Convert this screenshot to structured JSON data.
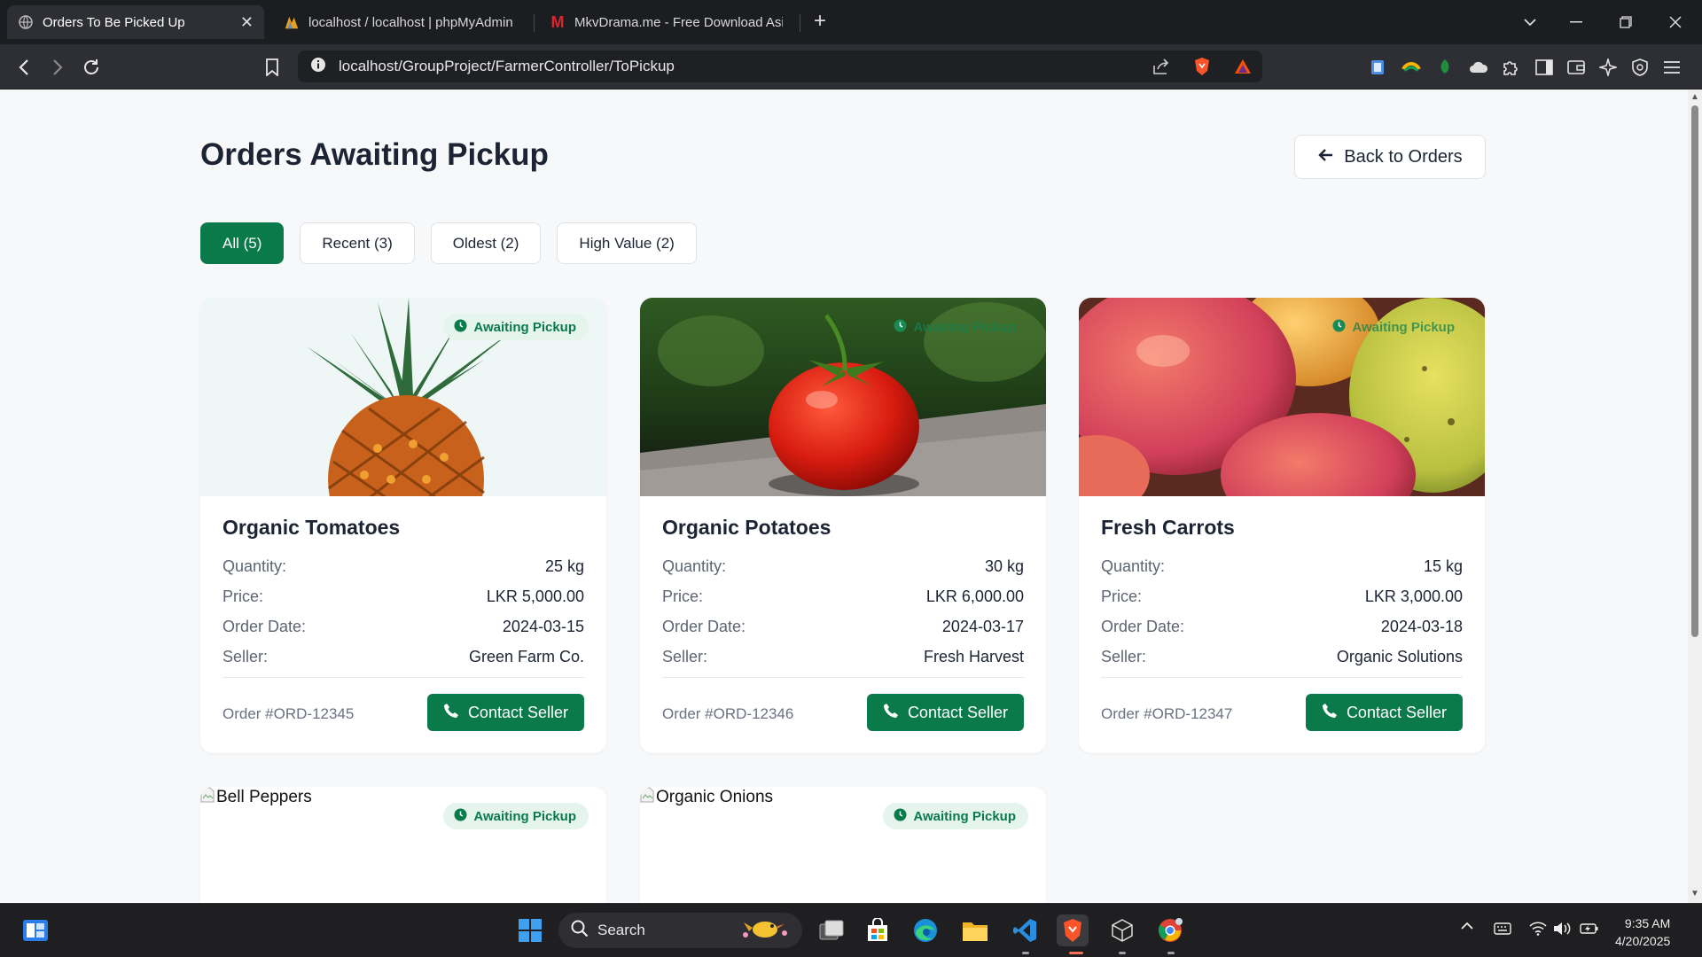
{
  "browser": {
    "tabs": [
      {
        "title": "Orders To Be Picked Up",
        "active": true
      },
      {
        "title": "localhost / localhost | phpMyAdmin",
        "active": false
      },
      {
        "title": "MkvDrama.me - Free Download Asi",
        "active": false
      }
    ],
    "url": "localhost/GroupProject/FarmerController/ToPickup"
  },
  "page": {
    "title": "Orders Awaiting Pickup",
    "back_label": "Back to Orders",
    "filters": [
      {
        "label": "All (5)",
        "active": true
      },
      {
        "label": "Recent (3)",
        "active": false
      },
      {
        "label": "Oldest (2)",
        "active": false
      },
      {
        "label": "High Value (2)",
        "active": false
      }
    ],
    "labels": {
      "quantity": "Quantity:",
      "price": "Price:",
      "order_date": "Order Date:",
      "seller": "Seller:",
      "contact": "Contact Seller",
      "badge": "Awaiting Pickup"
    },
    "orders": [
      {
        "name": "Organic Tomatoes",
        "quantity": "25 kg",
        "price": "LKR 5,000.00",
        "date": "2024-03-15",
        "seller": "Green Farm Co.",
        "order_id": "Order #ORD-12345",
        "image": "pineapple"
      },
      {
        "name": "Organic Potatoes",
        "quantity": "30 kg",
        "price": "LKR 6,000.00",
        "date": "2024-03-17",
        "seller": "Fresh Harvest",
        "order_id": "Order #ORD-12346",
        "image": "tomato"
      },
      {
        "name": "Fresh Carrots",
        "quantity": "15 kg",
        "price": "LKR 3,000.00",
        "date": "2024-03-18",
        "seller": "Organic Solutions",
        "order_id": "Order #ORD-12347",
        "image": "mango"
      },
      {
        "name": "Bell Peppers",
        "image_alt": "Bell Peppers",
        "image": "broken"
      },
      {
        "name": "Organic Onions",
        "image_alt": "Organic Onions",
        "image": "broken"
      }
    ]
  },
  "taskbar": {
    "search_label": "Search",
    "time": "9:35 AM",
    "date": "4/20/2025"
  }
}
